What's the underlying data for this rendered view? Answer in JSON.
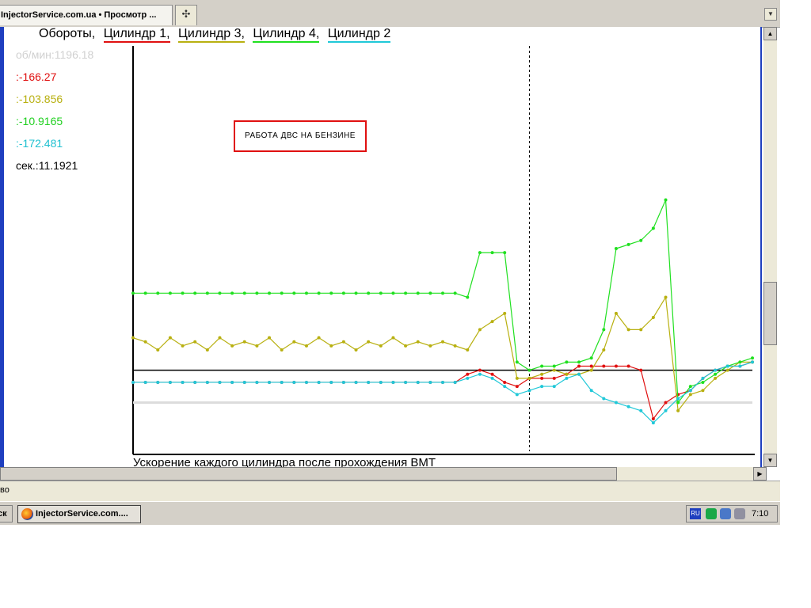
{
  "browser": {
    "tab_title": "InjectorService.com.ua • Просмотр ...",
    "new_tab_icon": "plus-move-icon",
    "status_text": "во"
  },
  "taskbar": {
    "start_label": "ск",
    "task_label": "InjectorService.com....",
    "tray_lang": "RU",
    "clock": "7:10"
  },
  "legend": {
    "rpm_label": "Обороты,",
    "cyl1_label": "Цилиндр 1,",
    "cyl3_label": "Цилиндр 3,",
    "cyl4_label": "Цилиндр 4,",
    "cyl2_label": "Цилиндр 2"
  },
  "readouts": {
    "rpm": "об/мин:1196.18",
    "cyl1": ":-166.27",
    "cyl3": ":-103.856",
    "cyl4": ":-10.9165",
    "cyl2": ":-172.481",
    "sec": "сек.:11.1921"
  },
  "note": "РАБОТА ДВС НА БЕНЗИНЕ",
  "caption": "Ускорение каждого цилиндра после прохождения ВМТ",
  "colors": {
    "rpm": "#dcdcdc",
    "cyl1": "#e01010",
    "cyl3": "#b8b010",
    "cyl4": "#20e020",
    "cyl2": "#20c8d8",
    "border": "#1f3fbf"
  },
  "chart_data": {
    "type": "line",
    "x": [
      0,
      2,
      4,
      6,
      8,
      10,
      12,
      14,
      16,
      18,
      20,
      22,
      24,
      26,
      28,
      30,
      32,
      34,
      36,
      38,
      40,
      42,
      44,
      46,
      48,
      50,
      52,
      54,
      56,
      58,
      60,
      62,
      64,
      66,
      68,
      70,
      72,
      74,
      76,
      78,
      80,
      82,
      84,
      86,
      88,
      90,
      92,
      94,
      96,
      98,
      100
    ],
    "series": [
      {
        "name": "Обороты",
        "values": [
          0.12,
          0.12,
          0.12,
          0.12,
          0.12,
          0.12,
          0.12,
          0.12,
          0.12,
          0.12,
          0.12,
          0.12,
          0.12,
          0.12,
          0.12,
          0.12,
          0.12,
          0.12,
          0.12,
          0.12,
          0.12,
          0.12,
          0.12,
          0.12,
          0.12,
          0.12,
          0.12,
          0.12,
          0.12,
          0.12,
          0.12,
          0.12,
          0.12,
          0.12,
          0.12,
          0.12,
          0.12,
          0.12,
          0.12,
          0.12,
          0.12,
          0.12,
          0.12,
          0.12,
          0.12,
          0.12,
          0.12,
          0.12,
          0.12,
          0.12,
          0.12
        ]
      },
      {
        "name": "Цилиндр 1",
        "values": [
          0.17,
          0.17,
          0.17,
          0.17,
          0.17,
          0.17,
          0.17,
          0.17,
          0.17,
          0.17,
          0.17,
          0.17,
          0.17,
          0.17,
          0.17,
          0.17,
          0.17,
          0.17,
          0.17,
          0.17,
          0.17,
          0.17,
          0.17,
          0.17,
          0.17,
          0.17,
          0.17,
          0.19,
          0.2,
          0.19,
          0.17,
          0.16,
          0.18,
          0.18,
          0.18,
          0.19,
          0.21,
          0.21,
          0.21,
          0.21,
          0.21,
          0.2,
          0.08,
          0.12,
          0.14,
          0.15,
          0.18,
          0.2,
          0.21,
          0.21,
          0.22
        ]
      },
      {
        "name": "Цилиндр 3",
        "values": [
          0.28,
          0.27,
          0.25,
          0.28,
          0.26,
          0.27,
          0.25,
          0.28,
          0.26,
          0.27,
          0.26,
          0.28,
          0.25,
          0.27,
          0.26,
          0.28,
          0.26,
          0.27,
          0.25,
          0.27,
          0.26,
          0.28,
          0.26,
          0.27,
          0.26,
          0.27,
          0.26,
          0.25,
          0.3,
          0.32,
          0.34,
          0.18,
          0.18,
          0.19,
          0.2,
          0.19,
          0.19,
          0.2,
          0.25,
          0.34,
          0.3,
          0.3,
          0.33,
          0.38,
          0.1,
          0.14,
          0.15,
          0.18,
          0.2,
          0.22,
          0.22
        ]
      },
      {
        "name": "Цилиндр 4",
        "values": [
          0.39,
          0.39,
          0.39,
          0.39,
          0.39,
          0.39,
          0.39,
          0.39,
          0.39,
          0.39,
          0.39,
          0.39,
          0.39,
          0.39,
          0.39,
          0.39,
          0.39,
          0.39,
          0.39,
          0.39,
          0.39,
          0.39,
          0.39,
          0.39,
          0.39,
          0.39,
          0.39,
          0.38,
          0.49,
          0.49,
          0.49,
          0.22,
          0.2,
          0.21,
          0.21,
          0.22,
          0.22,
          0.23,
          0.3,
          0.5,
          0.51,
          0.52,
          0.55,
          0.62,
          0.12,
          0.16,
          0.17,
          0.19,
          0.21,
          0.22,
          0.23
        ]
      },
      {
        "name": "Цилиндр 2",
        "values": [
          0.17,
          0.17,
          0.17,
          0.17,
          0.17,
          0.17,
          0.17,
          0.17,
          0.17,
          0.17,
          0.17,
          0.17,
          0.17,
          0.17,
          0.17,
          0.17,
          0.17,
          0.17,
          0.17,
          0.17,
          0.17,
          0.17,
          0.17,
          0.17,
          0.17,
          0.17,
          0.17,
          0.18,
          0.19,
          0.18,
          0.16,
          0.14,
          0.15,
          0.16,
          0.16,
          0.18,
          0.19,
          0.15,
          0.13,
          0.12,
          0.11,
          0.1,
          0.07,
          0.1,
          0.13,
          0.15,
          0.18,
          0.2,
          0.21,
          0.21,
          0.22
        ]
      }
    ],
    "xlim": [
      0,
      100
    ],
    "ylim": [
      0,
      1
    ],
    "zero_line": 0.2,
    "cursor_x": 64,
    "grid": false
  }
}
